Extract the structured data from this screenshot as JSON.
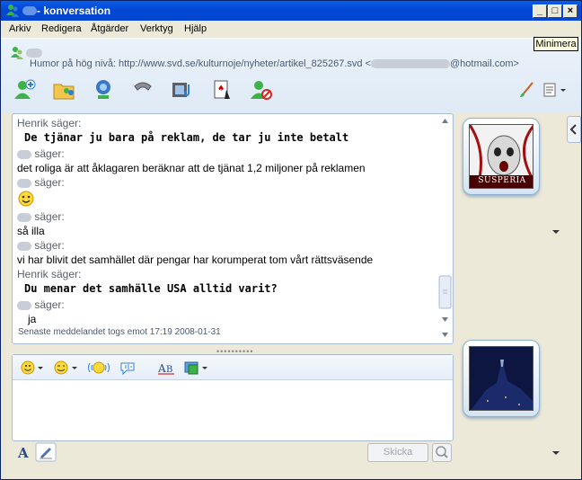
{
  "window": {
    "title": "- konversation",
    "min_label": "_",
    "max_label": "□",
    "close_label": "×"
  },
  "menu": {
    "items": [
      "Arkiv",
      "Redigera",
      "Åtgärder",
      "Verktyg",
      "Hjälp"
    ]
  },
  "tooltip": {
    "text": "Minimera"
  },
  "header": {
    "subject_prefix": "Humor på hög nivå:  http://www.svd.se/kulturnoje/nyheter/artikel_825267.svd  <",
    "subject_suffix": "@hotmail.com>"
  },
  "toolbar": {
    "icons": [
      "add-contact-icon",
      "share-folders-icon",
      "webcam-icon",
      "call-icon",
      "video-clip-icon",
      "games-icon",
      "block-icon",
      "paintbrush-icon",
      "menu-icon"
    ]
  },
  "conversation": {
    "messages": [
      {
        "sender": "Henrik säger:",
        "text": "De tjänar ju bara på reklam, de tar ju inte betalt",
        "style": "bold"
      },
      {
        "sender": "säger:",
        "text": "det roliga är att åklagaren beräknar att de tjänat 1,2 miljoner på reklamen",
        "style": "normal"
      },
      {
        "sender": "säger:",
        "text": "",
        "style": "emoticon"
      },
      {
        "sender": "säger:",
        "text": "så illa",
        "style": "normal"
      },
      {
        "sender": "säger:",
        "text": "vi har blivit det samhället där pengar har korumperat tom vårt rättsväsende",
        "style": "normal"
      },
      {
        "sender": "Henrik säger:",
        "text": "Du menar det samhälle USA alltid varit?",
        "style": "bold"
      },
      {
        "sender": "säger:",
        "text": "ja",
        "style": "normal"
      }
    ],
    "status": "Senaste meddelandet togs emot 17:19 2008-01-31",
    "divider": "••••••••••"
  },
  "compose": {
    "send_label": "Skicka",
    "draft": ""
  },
  "avatars": {
    "contact_caption": "SUSPERIA"
  },
  "colors": {
    "titlebar": "#0348d6",
    "panel_border": "#a9bcd4",
    "header_bg": "#eaf2fa"
  }
}
